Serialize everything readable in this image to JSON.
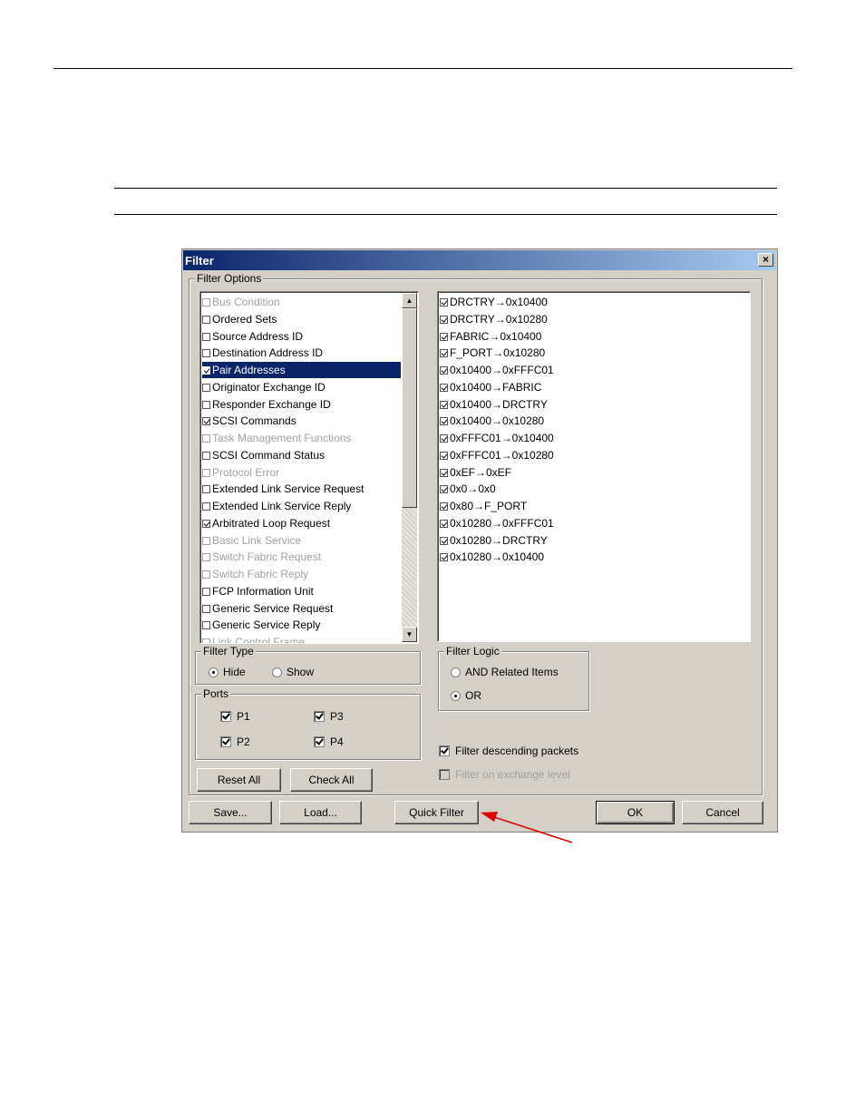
{
  "dialog": {
    "title": "Filter",
    "close_label": "×",
    "filter_options_label": "Filter Options",
    "left_list": [
      {
        "label": "Bus Condition",
        "checked": false,
        "disabled": true
      },
      {
        "label": "Ordered Sets",
        "checked": false,
        "disabled": false
      },
      {
        "label": "Source Address ID",
        "checked": false,
        "disabled": false
      },
      {
        "label": "Destination Address ID",
        "checked": false,
        "disabled": false
      },
      {
        "label": "Pair Addresses",
        "checked": true,
        "disabled": false,
        "selected": true
      },
      {
        "label": "Originator Exchange ID",
        "checked": false,
        "disabled": false
      },
      {
        "label": "Responder Exchange ID",
        "checked": false,
        "disabled": false
      },
      {
        "label": "SCSI Commands",
        "checked": true,
        "disabled": false
      },
      {
        "label": "Task Management Functions",
        "checked": false,
        "disabled": true
      },
      {
        "label": "SCSI Command Status",
        "checked": false,
        "disabled": false
      },
      {
        "label": "Protocol Error",
        "checked": false,
        "disabled": true
      },
      {
        "label": "Extended Link Service Request",
        "checked": false,
        "disabled": false
      },
      {
        "label": "Extended Link Service Reply",
        "checked": false,
        "disabled": false
      },
      {
        "label": "Arbitrated Loop Request",
        "checked": true,
        "disabled": false
      },
      {
        "label": "Basic Link Service",
        "checked": false,
        "disabled": true
      },
      {
        "label": "Switch Fabric Request",
        "checked": false,
        "disabled": true
      },
      {
        "label": "Switch Fabric Reply",
        "checked": false,
        "disabled": true
      },
      {
        "label": "FCP Information Unit",
        "checked": false,
        "disabled": false
      },
      {
        "label": "Generic Service Request",
        "checked": false,
        "disabled": false
      },
      {
        "label": "Generic Service Reply",
        "checked": false,
        "disabled": false
      },
      {
        "label": "Link Control Frame",
        "checked": false,
        "disabled": true
      }
    ],
    "right_list": [
      "DRCTRY→0x10400",
      "DRCTRY→0x10280",
      "FABRIC→0x10400",
      "F_PORT→0x10280",
      "0x10400→0xFFFC01",
      "0x10400→FABRIC",
      "0x10400→DRCTRY",
      "0x10400→0x10280",
      "0xFFFC01→0x10400",
      "0xFFFC01→0x10280",
      "0xEF→0xEF",
      "0x0→0x0",
      "0x80→F_PORT",
      "0x10280→0xFFFC01",
      "0x10280→DRCTRY",
      "0x10280→0x10400"
    ],
    "filter_type": {
      "label": "Filter Type",
      "hide": "Hide",
      "show": "Show",
      "selected": "Hide"
    },
    "filter_logic": {
      "label": "Filter Logic",
      "and": "AND Related Items",
      "or": "OR",
      "selected": "OR"
    },
    "ports": {
      "label": "Ports",
      "p1": "P1",
      "p2": "P2",
      "p3": "P3",
      "p4": "P4"
    },
    "filter_descending": "Filter descending packets",
    "filter_exchange": "Filter on exchange level",
    "buttons": {
      "reset_all": "Reset All",
      "check_all": "Check All",
      "save": "Save...",
      "load": "Load...",
      "quick_filter": "Quick Filter",
      "ok": "OK",
      "cancel": "Cancel"
    }
  },
  "colors": {
    "accent": "#0a246a",
    "arrow": "#e00000",
    "face": "#d4d0c8"
  },
  "scroll_icons": {
    "up": "up-arrow-icon",
    "down": "down-arrow-icon"
  }
}
